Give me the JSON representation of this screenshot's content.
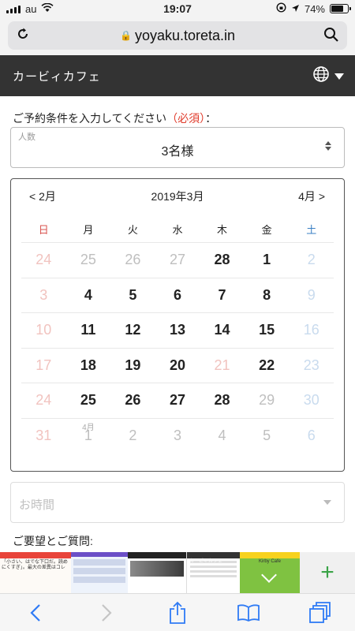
{
  "status_bar": {
    "carrier": "au",
    "time": "19:07",
    "battery": "74%",
    "battery_level": 0.74
  },
  "browser": {
    "url": "yoyaku.toreta.in"
  },
  "site": {
    "name": "カービィカフェ"
  },
  "form": {
    "prompt": "ご予約条件を入力してください",
    "required": "（必須）",
    "prompt_suffix": "：",
    "party_label": "人数",
    "party_value": "3名様",
    "time_placeholder": "お時間",
    "requests_label": "ご要望とご質問:"
  },
  "calendar": {
    "prev": "< 2月",
    "title": "2019年3月",
    "next": "4月 >",
    "weekdays": [
      "日",
      "月",
      "火",
      "水",
      "木",
      "金",
      "土"
    ],
    "weeks": [
      [
        {
          "d": "24",
          "s": "na-sun"
        },
        {
          "d": "25",
          "s": "na"
        },
        {
          "d": "26",
          "s": "na"
        },
        {
          "d": "27",
          "s": "na"
        },
        {
          "d": "28",
          "s": "avail"
        },
        {
          "d": "1",
          "s": "avail"
        },
        {
          "d": "2",
          "s": "na-sat"
        }
      ],
      [
        {
          "d": "3",
          "s": "na-sun"
        },
        {
          "d": "4",
          "s": "avail"
        },
        {
          "d": "5",
          "s": "avail"
        },
        {
          "d": "6",
          "s": "avail"
        },
        {
          "d": "7",
          "s": "avail"
        },
        {
          "d": "8",
          "s": "avail"
        },
        {
          "d": "9",
          "s": "na-sat"
        }
      ],
      [
        {
          "d": "10",
          "s": "na-sun"
        },
        {
          "d": "11",
          "s": "avail"
        },
        {
          "d": "12",
          "s": "avail"
        },
        {
          "d": "13",
          "s": "avail"
        },
        {
          "d": "14",
          "s": "avail"
        },
        {
          "d": "15",
          "s": "avail"
        },
        {
          "d": "16",
          "s": "na-sat"
        }
      ],
      [
        {
          "d": "17",
          "s": "na-sun"
        },
        {
          "d": "18",
          "s": "avail"
        },
        {
          "d": "19",
          "s": "avail"
        },
        {
          "d": "20",
          "s": "avail"
        },
        {
          "d": "21",
          "s": "na-sun"
        },
        {
          "d": "22",
          "s": "avail"
        },
        {
          "d": "23",
          "s": "na-sat"
        }
      ],
      [
        {
          "d": "24",
          "s": "na-sun"
        },
        {
          "d": "25",
          "s": "avail"
        },
        {
          "d": "26",
          "s": "avail"
        },
        {
          "d": "27",
          "s": "avail"
        },
        {
          "d": "28",
          "s": "avail"
        },
        {
          "d": "29",
          "s": "na"
        },
        {
          "d": "30",
          "s": "na-sat"
        }
      ],
      [
        {
          "d": "31",
          "s": "na-sun"
        },
        {
          "d": "1",
          "s": "na",
          "m": "4月"
        },
        {
          "d": "2",
          "s": "na"
        },
        {
          "d": "3",
          "s": "na"
        },
        {
          "d": "4",
          "s": "na"
        },
        {
          "d": "5",
          "s": "na"
        },
        {
          "d": "6",
          "s": "na-sat"
        }
      ]
    ]
  },
  "tab_strip": {
    "tab1_text": "「小さい、はでな下口だ。読めにくすぎ」。最大の差異はコレ",
    "tab1_brand": "オーガニズム",
    "tab4_title": "カービィカフェ",
    "tab5_label": "Kirby Cafe"
  },
  "colors": {
    "header_bg": "#333333",
    "required": "#e03a2a",
    "sunday": "#d9534f",
    "saturday": "#3a7fc4",
    "accent": "#3aa347"
  },
  "icons": [
    "reload-icon",
    "lock-icon",
    "search-icon",
    "globe-icon",
    "back-icon",
    "forward-icon",
    "share-icon",
    "bookmarks-icon",
    "tabs-icon",
    "plus-icon"
  ]
}
